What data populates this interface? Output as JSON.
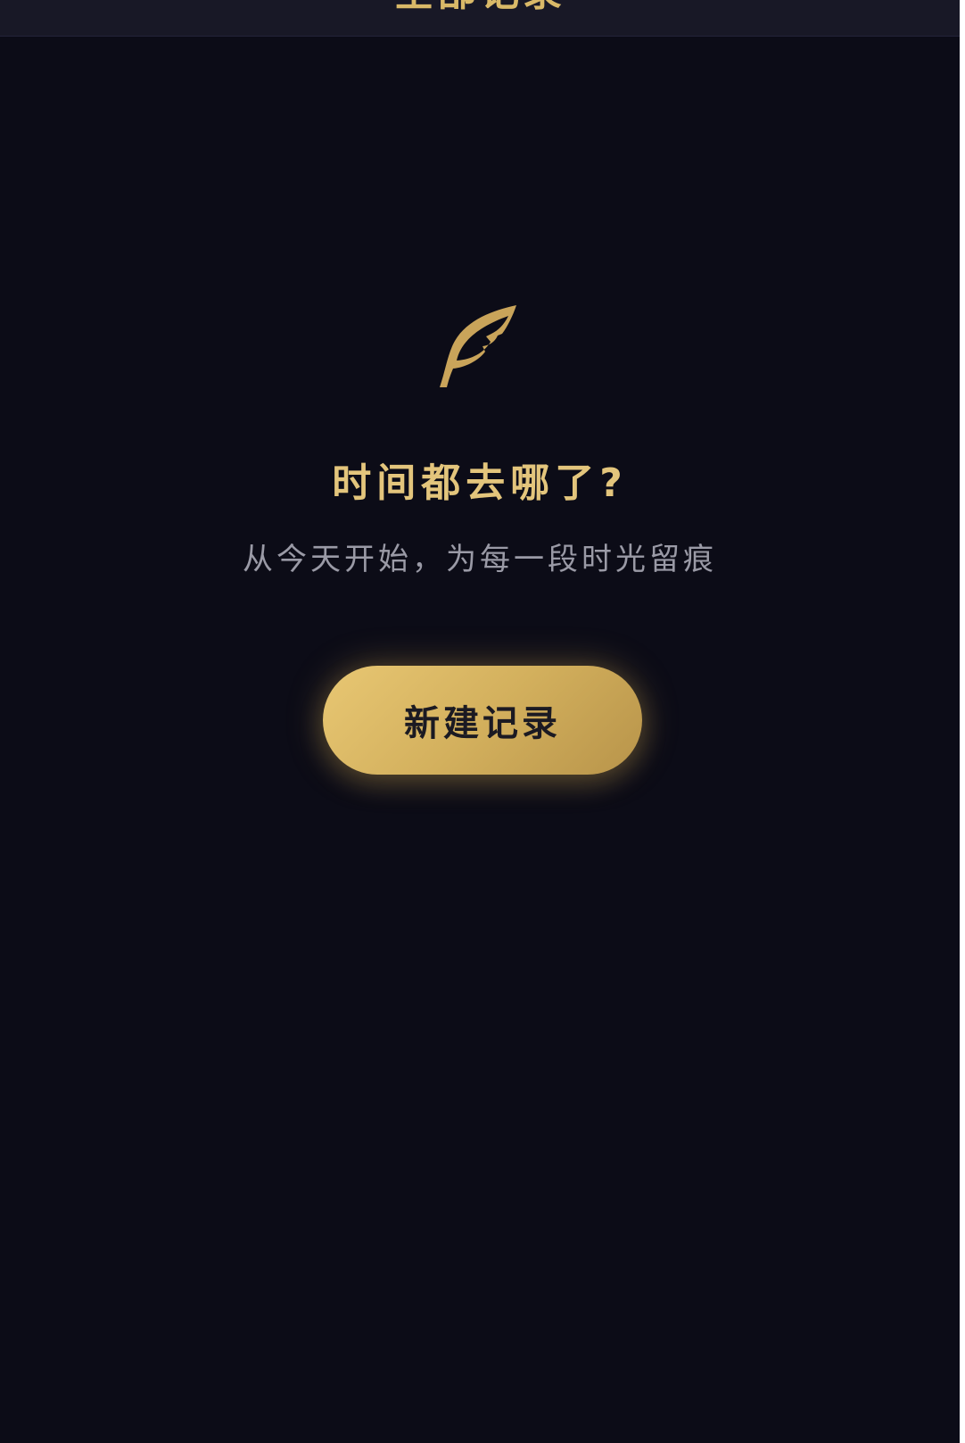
{
  "header": {
    "title": "全部记录"
  },
  "empty_state": {
    "icon": "feather-icon",
    "title": "时间都去哪了?",
    "subtitle": "从今天开始，为每一段时光留痕",
    "button_label": "新建记录"
  },
  "colors": {
    "background": "#0c0c17",
    "accent_gold": "#e3c57c",
    "subtitle_gray": "#9a9aa6",
    "button_text": "#1b1a22"
  }
}
